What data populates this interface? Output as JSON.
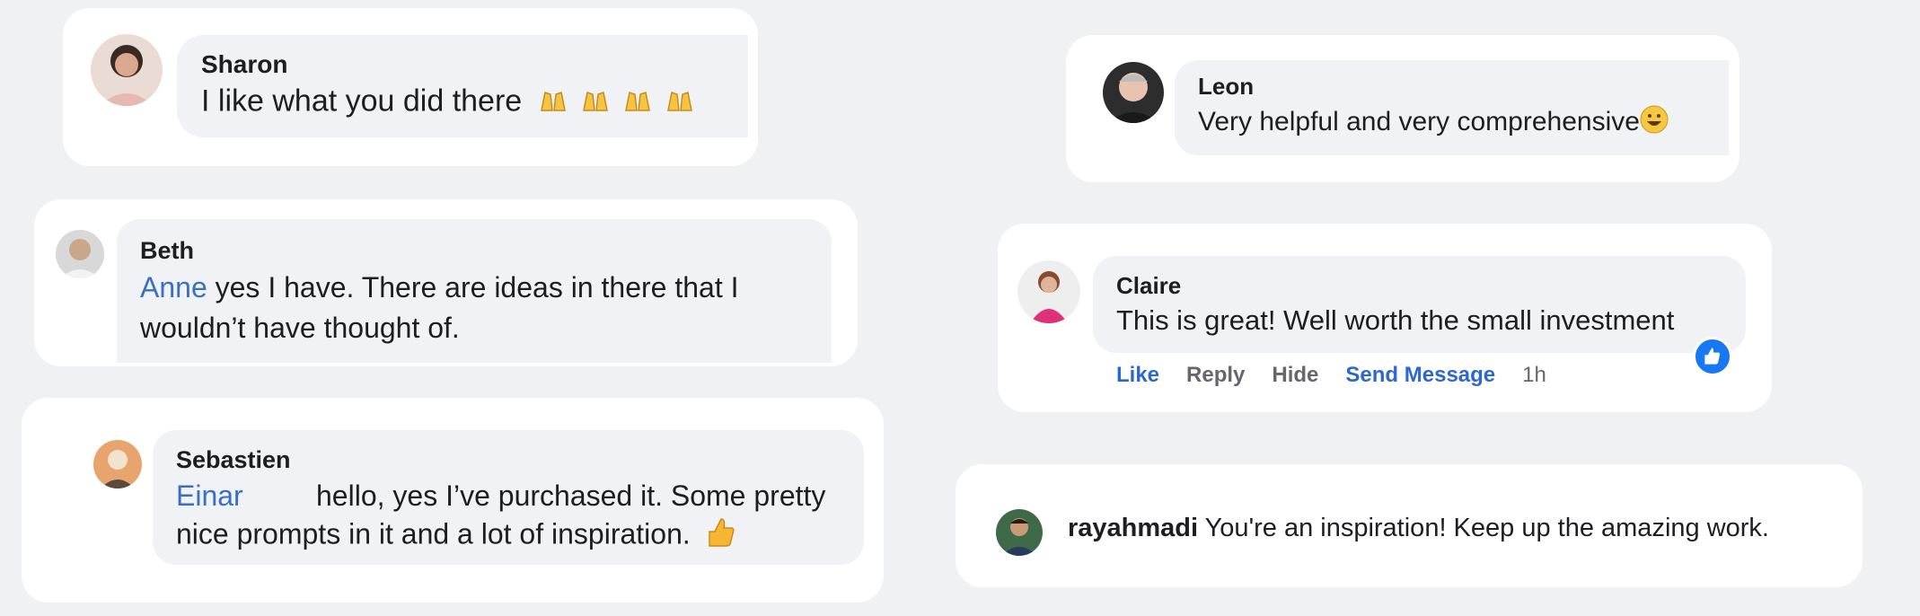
{
  "comments": {
    "sharon": {
      "name": "Sharon",
      "text": "I like what you did there",
      "emoji_icon": "raising-hands-emoji"
    },
    "beth": {
      "name": "Beth",
      "mention": "Anne",
      "line1": " yes I have. There are ideas in there that I",
      "line2": "wouldn’t have thought of."
    },
    "sebastien": {
      "name": "Sebastien",
      "mention": "Einar",
      "line1": "hello, yes I’ve purchased it. Some pretty",
      "line2": "nice prompts in it and a lot of inspiration.",
      "emoji_icon": "thumbs-up-emoji"
    },
    "leon": {
      "name": "Leon",
      "text": "Very helpful and very comprehensive",
      "emoji_icon": "grinning-face-emoji"
    },
    "claire": {
      "name": "Claire",
      "text": "This is great! Well worth the small investment",
      "actions": {
        "like": "Like",
        "reply": "Reply",
        "hide": "Hide",
        "send_message": "Send Message",
        "time": "1h"
      },
      "reaction_icon": "like-reaction-icon"
    },
    "rayahmadi": {
      "name": "rayahmadi",
      "text": "You're an inspiration! Keep up the amazing work."
    }
  },
  "colors": {
    "background": "#f0f1f3",
    "card": "#ffffff",
    "bubble": "#f0f2f5",
    "mention": "#3a6fc4",
    "action_blue": "#2e67d1",
    "action_gray": "#65676b",
    "like_blue": "#1877f2"
  }
}
